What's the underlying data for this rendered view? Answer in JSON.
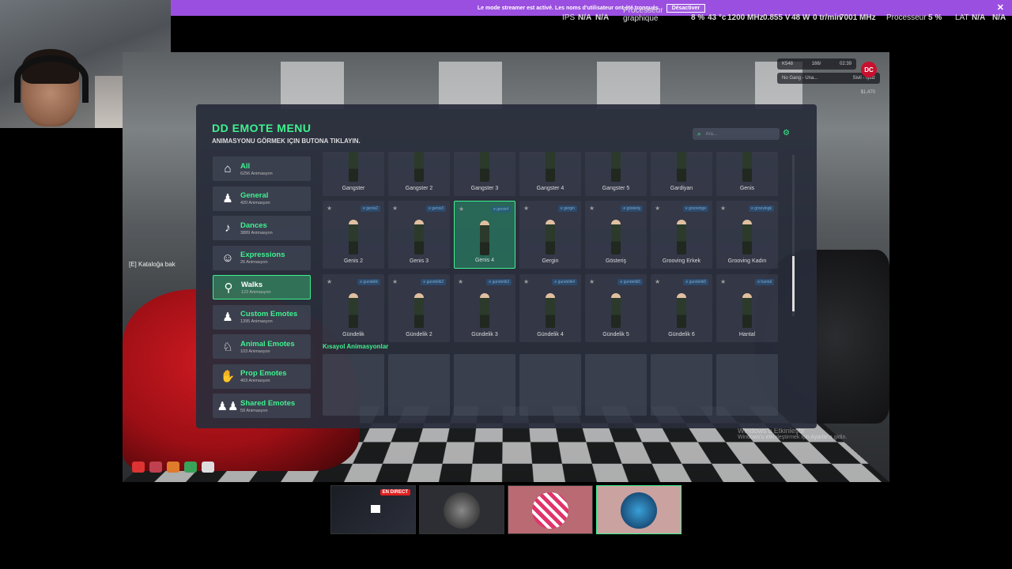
{
  "banner": {
    "message": "Le mode streamer est activé. Les noms d'utilisateur ont été tronqués.",
    "button": "Désactiver",
    "close": "✕"
  },
  "perf": {
    "ips_label": "IPS",
    "ips_value1": "N/A",
    "ips_value2": "N/A",
    "gpu_label1": "Processeur",
    "gpu_label2": "graphique",
    "gpu_usage": "8 %",
    "gpu_temp": "43 °c",
    "gpu_clock": "1200 MHz",
    "gpu_voltage": "0.855 V",
    "gpu_power": "48 W",
    "gpu_fan": "0 tr/min",
    "gpu_mem_clock": "7001 MHz",
    "cpu_label": "Processeur",
    "cpu_usage": "5 %",
    "lat_label": "LAT",
    "lat_value1": "N/A",
    "lat_value2": "N/A"
  },
  "game": {
    "catalog_hint": "[E] Kataloğa bak",
    "watermark_title": "Windows'u Etkinleştir",
    "watermark_sub": "Windows'u etkinleştirmek için Ayarlar'a gidin.",
    "hud": {
      "players": "K548",
      "ping": "166/",
      "time": "02:39",
      "gang": "No Gang - Una...",
      "job": "Sivil - İşsiz",
      "money": "$1,470"
    }
  },
  "menu": {
    "title": "DD EMOTE MENU",
    "subtitle": "ANIMASYONU GÖRMEK IÇIN BUTONA TIKLAYIN.",
    "search_placeholder": "Ara...",
    "shortcut_title": "Kısayol Animasyonlar",
    "categories": [
      {
        "name": "All",
        "count": "6256 Animasyon",
        "icon": "home-icon",
        "glyph": "⌂"
      },
      {
        "name": "General",
        "count": "420 Animasyon",
        "icon": "person-icon",
        "glyph": "♟"
      },
      {
        "name": "Dances",
        "count": "3889 Animasyon",
        "icon": "dance-icon",
        "glyph": "♪"
      },
      {
        "name": "Expressions",
        "count": "26 Animasyon",
        "icon": "smiley-icon",
        "glyph": "☺"
      },
      {
        "name": "Walks",
        "count": "122 Animasyon",
        "icon": "walk-icon",
        "glyph": "⚲"
      },
      {
        "name": "Custom Emotes",
        "count": "1395 Animasyon",
        "icon": "person-icon",
        "glyph": "♟"
      },
      {
        "name": "Animal Emotes",
        "count": "103 Animasyon",
        "icon": "dog-icon",
        "glyph": "♘"
      },
      {
        "name": "Prop Emotes",
        "count": "403 Animasyon",
        "icon": "hands-icon",
        "glyph": "✋"
      },
      {
        "name": "Shared Emotes",
        "count": "59 Animasyon",
        "icon": "people-icon",
        "glyph": "♟♟"
      }
    ],
    "active_category": 4,
    "emotes_row1": [
      "Gangster",
      "Gangster 2",
      "Gangster 3",
      "Gangster 4",
      "Gangster 5",
      "Gardiyan",
      "Genis"
    ],
    "emotes_row2": [
      {
        "label": "Genis 2",
        "tag": "e genis2"
      },
      {
        "label": "Genis 3",
        "tag": "e genis3"
      },
      {
        "label": "Genis 4",
        "tag": "e genis4"
      },
      {
        "label": "Gergin",
        "tag": "e gergin"
      },
      {
        "label": "Gösteriş",
        "tag": "e gösteriş"
      },
      {
        "label": "Grooving Erkek",
        "tag": "e groovinge"
      },
      {
        "label": "Grooving Kadın",
        "tag": "e groovingk"
      }
    ],
    "emotes_row3": [
      {
        "label": "Gündelik",
        "tag": "e gundelik"
      },
      {
        "label": "Gündelik 2",
        "tag": "e gundelik2"
      },
      {
        "label": "Gündelik 3",
        "tag": "e gundelik3"
      },
      {
        "label": "Gündelik 4",
        "tag": "e gundelik4"
      },
      {
        "label": "Gündelik 5",
        "tag": "e gundelik5"
      },
      {
        "label": "Gündelik 6",
        "tag": "e gundelik6"
      },
      {
        "label": "Hantal",
        "tag": "e hantal"
      }
    ],
    "selected_emote": "Genis 4"
  },
  "scenes": {
    "live_badge": "EN DIRECT"
  }
}
